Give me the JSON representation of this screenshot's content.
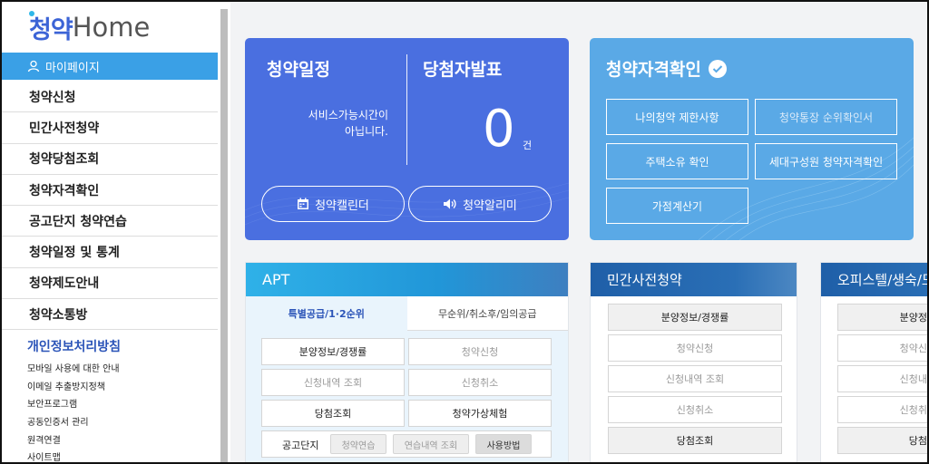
{
  "logo": {
    "korean": "청약",
    "english": "Home"
  },
  "sidebar": {
    "mypage": "마이페이지",
    "items": [
      "청약신청",
      "민간사전청약",
      "청약당첨조회",
      "청약자격확인",
      "공고단지 청약연습",
      "청약일정 및 통계",
      "청약제도안내",
      "청약소통방"
    ],
    "privacy": "개인정보처리방침",
    "links": [
      "모바일 사용에 대한 안내",
      "이메일 추출방지정책",
      "보안프로그램",
      "공동인증서 관리",
      "원격연결",
      "사이트맵"
    ]
  },
  "schedule_card": {
    "title_left": "청약일정",
    "title_right": "당첨자발표",
    "notice_line1": "서비스가능시간이",
    "notice_line2": "아닙니다.",
    "count": "0",
    "unit": "건",
    "calendar_button": "청약캘린더",
    "alarm_button": "청약알리미"
  },
  "qualify_card": {
    "title": "청약자격확인",
    "buttons": [
      "나의청약 제한사항",
      "청약통장 순위확인서",
      "주택소유 확인",
      "세대구성원 청약자격확인",
      "가점계산기"
    ]
  },
  "apt_panel": {
    "title": "APT",
    "tab_active": "특별공급/1·2순위",
    "tab_inactive": "무순위/취소후/임의공급",
    "buttons": [
      "분양정보/경쟁률",
      "청약신청",
      "신청내역 조회",
      "신청취소",
      "당첨조회",
      "청약가상체험"
    ],
    "notice_label": "공고단지",
    "small_buttons": [
      "청약연습",
      "연습내역 조회",
      "사용방법"
    ]
  },
  "private_panel": {
    "title": "민간사전청약",
    "buttons": [
      "분양정보/경쟁률",
      "청약신청",
      "신청내역 조회",
      "신청취소",
      "당첨조회"
    ]
  },
  "officetel_panel": {
    "title": "오피스텔/생숙/도",
    "buttons": [
      "분양정",
      "청약신",
      "신청내",
      "신청취",
      "당첨"
    ]
  }
}
